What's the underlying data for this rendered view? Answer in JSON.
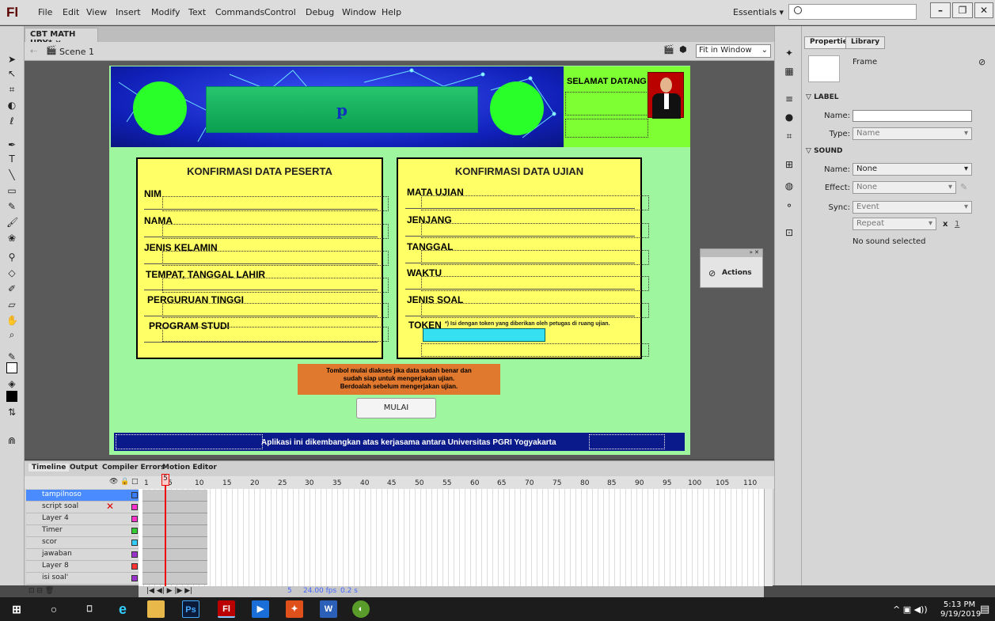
{
  "app": {
    "logo": "Fl",
    "menu": [
      "File",
      "Edit",
      "View",
      "Insert",
      "Modify",
      "Text",
      "Commands",
      "Control",
      "Debug",
      "Window",
      "Help"
    ],
    "workspace": "Essentials ▾",
    "search_placeholder": ""
  },
  "document": {
    "tab": "CBT MATH UPY* ×",
    "scene": "Scene 1",
    "zoom": "Fit in Window"
  },
  "stage": {
    "welcome": "SELAMAT DATANG",
    "title": "p",
    "card_left": {
      "title": "KONFIRMASI DATA PESERTA",
      "fields": [
        "NIM",
        "NAMA",
        "JENIS KELAMIN",
        "TEMPAT, TANGGAL LAHIR",
        "PERGURUAN TINGGI",
        "PROGRAM STUDI"
      ]
    },
    "card_right": {
      "title": "KONFIRMASI DATA UJIAN",
      "fields": [
        "MATA UJIAN",
        "JENJANG",
        "TANGGAL",
        "WAKTU",
        "JENIS SOAL",
        "TOKEN"
      ],
      "token_note": "*) Isi dengan token yang diberikan oleh petugas di ruang ujian."
    },
    "note": [
      "Tombol mulai diakses jika data sudah benar dan",
      "sudah siap untuk mengerjakan ujian.",
      "Berdoalah sebelum mengerjakan ujian."
    ],
    "start_button": "MULAI",
    "footer": "Aplikasi ini dikembangkan atas kerjasama antara Universitas PGRI Yogyakarta"
  },
  "actions_panel": {
    "label": "Actions"
  },
  "properties": {
    "tabs": [
      "Properties",
      "Library"
    ],
    "type": "Frame",
    "label_section": "LABEL",
    "name_label": "Name:",
    "type_label": "Type:",
    "type_value": "Name",
    "sound_section": "SOUND",
    "sound_name_label": "Name:",
    "sound_name": "None",
    "effect_label": "Effect:",
    "effect": "None",
    "sync_label": "Sync:",
    "sync": "Event",
    "repeat": "Repeat",
    "repeat_x": "x",
    "repeat_count": "1",
    "status": "No sound selected"
  },
  "timeline": {
    "tabs": [
      "Timeline",
      "Output",
      "Compiler Errors",
      "Motion Editor"
    ],
    "numbers": [
      "1",
      "5",
      "10",
      "15",
      "20",
      "25",
      "30",
      "35",
      "40",
      "45",
      "50",
      "55",
      "60",
      "65",
      "70",
      "75",
      "80",
      "85",
      "90",
      "95",
      "100",
      "105",
      "110"
    ],
    "layers": [
      {
        "name": "tampilnoso",
        "color": "#3a7cff"
      },
      {
        "name": "script soal",
        "color": "#ff33cc"
      },
      {
        "name": "Layer 4",
        "color": "#ff33cc"
      },
      {
        "name": "Timer",
        "color": "#33cc33"
      },
      {
        "name": "scor",
        "color": "#33ccff"
      },
      {
        "name": "jawaban",
        "color": "#9933cc"
      },
      {
        "name": "Layer 8",
        "color": "#ff3333"
      },
      {
        "name": "isi soal'",
        "color": "#9933cc"
      }
    ],
    "current_frame": "5",
    "fps": "24.00 fps",
    "time": "0.2 s"
  },
  "taskbar": {
    "time": "5:13 PM",
    "date": "9/19/2019"
  }
}
